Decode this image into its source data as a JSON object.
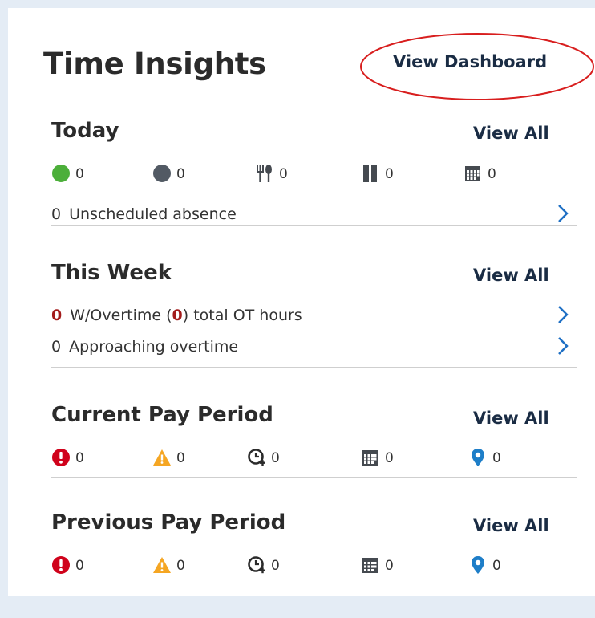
{
  "widget": {
    "title": "Time Insights",
    "dashboard_link": "View Dashboard"
  },
  "today": {
    "title": "Today",
    "view_all": "View All",
    "stats": [
      {
        "icon": "green-circle-icon",
        "value": "0"
      },
      {
        "icon": "gray-circle-icon",
        "value": "0"
      },
      {
        "icon": "meal-icon",
        "value": "0"
      },
      {
        "icon": "pause-icon",
        "value": "0"
      },
      {
        "icon": "calendar-icon",
        "value": "0"
      }
    ],
    "unscheduled": {
      "count": "0",
      "label": "Unscheduled absence"
    }
  },
  "this_week": {
    "title": "This Week",
    "view_all": "View All",
    "overtime": {
      "count": "0",
      "label_before": "W/Overtime (",
      "ot_hours": "0",
      "label_after": ") total OT hours"
    },
    "approaching": {
      "count": "0",
      "label": "Approaching overtime"
    }
  },
  "current_pay_period": {
    "title": "Current Pay Period",
    "view_all": "View All",
    "stats": [
      {
        "icon": "exclamation-icon",
        "value": "0"
      },
      {
        "icon": "warning-icon",
        "value": "0"
      },
      {
        "icon": "clock-plus-icon",
        "value": "0"
      },
      {
        "icon": "calendar-icon",
        "value": "0"
      },
      {
        "icon": "location-pin-icon",
        "value": "0"
      }
    ]
  },
  "previous_pay_period": {
    "title": "Previous Pay Period",
    "view_all": "View All",
    "stats": [
      {
        "icon": "exclamation-icon",
        "value": "0"
      },
      {
        "icon": "warning-icon",
        "value": "0"
      },
      {
        "icon": "clock-plus-icon",
        "value": "0"
      },
      {
        "icon": "calendar-icon",
        "value": "0"
      },
      {
        "icon": "location-pin-icon",
        "value": "0"
      }
    ]
  },
  "colors": {
    "accent_dark": "#1a2c44",
    "annotation": "#d81e1e",
    "alert_red": "#d0021b",
    "warning_orange": "#f5a623",
    "active_green": "#4caf3a",
    "location_blue": "#1e7ec8",
    "chevron_blue": "#1e6fc4",
    "overtime_red": "#a31b1b"
  }
}
